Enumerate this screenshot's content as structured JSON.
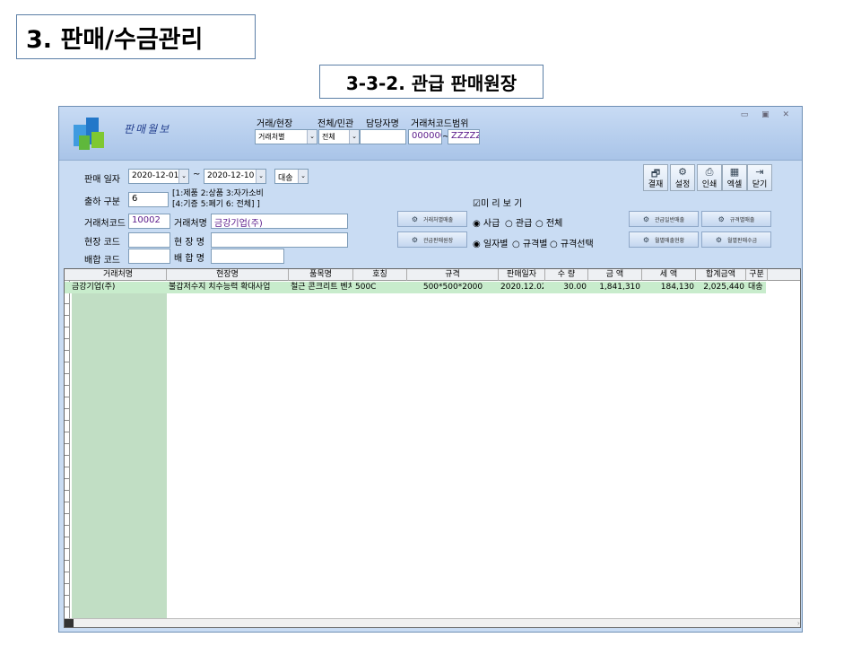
{
  "slide": {
    "title": "3. 판매/수금관리",
    "subtitle": "3-3-2. 관급 판매원장"
  },
  "app": {
    "title": "판매월보"
  },
  "filters": {
    "vendor_site_label": "거래/현장",
    "vendor_site_value": "거래처별",
    "all_gov_label": "전체/민관",
    "all_gov_value": "전체",
    "manager_label": "담당자명",
    "code_range_label": "거래처코드범위",
    "code_from": "000000",
    "code_sep": "~",
    "code_to": "ZZZZZZ"
  },
  "form": {
    "sale_date_label": "판매 일자",
    "date_from": "2020-12-01",
    "date_sep": "~",
    "date_to": "2020-12-10",
    "type_value": "대송",
    "ship_type_label": "출하 구분",
    "ship_type_value": "6",
    "ship_note_1": "[1:제품 2:상품 3:자가소비",
    "ship_note_2": "[4:기증 5:폐기 6: 전체] ]",
    "vendor_code_label": "거래처코드",
    "vendor_code_value": "10002",
    "vendor_name_label": "거래처명",
    "vendor_name_value": "금강기업(주)",
    "site_code_label": "현장 코드",
    "site_name_label": "현 장 명",
    "mix_code_label": "배합 코드",
    "mix_name_label": "배 합 명",
    "preview_label": "☑미 리 보 기"
  },
  "toolbar": [
    {
      "label": "결재",
      "icon": "approval-icon",
      "glyph": "🗗"
    },
    {
      "label": "설정",
      "icon": "settings-icon",
      "glyph": "⚙"
    },
    {
      "label": "인쇄",
      "icon": "print-icon",
      "glyph": "⎙"
    },
    {
      "label": "엑셀",
      "icon": "excel-icon",
      "glyph": "▦"
    },
    {
      "label": "닫기",
      "icon": "exit-icon",
      "glyph": "⇥"
    }
  ],
  "actions": [
    "거래처별매출",
    "관급일반매출",
    "규격별매출",
    "관급판매원장",
    "월별매출현황",
    "월별판매수금"
  ],
  "radios": {
    "g1": [
      "◉ 사급",
      "○ 관급",
      "○ 전체"
    ],
    "g2": [
      "◉ 일자별",
      "○ 규격별",
      "○ 규격선택"
    ]
  },
  "grid": {
    "headers": [
      "거래처명",
      "현장명",
      "품목명",
      "호칭",
      "규격",
      "판매일자",
      "수 량",
      "금 액",
      "세 액",
      "합계금액",
      "구분"
    ],
    "rows": [
      [
        "금강기업(주)",
        "불갑저수지 치수능력 확대사업",
        "철근 콘크리트 벤치플",
        "500C",
        "500*500*2000",
        "2020.12.02 (",
        "30.00",
        "1,841,310",
        "184,130",
        "2,025,440",
        "대송"
      ]
    ]
  }
}
